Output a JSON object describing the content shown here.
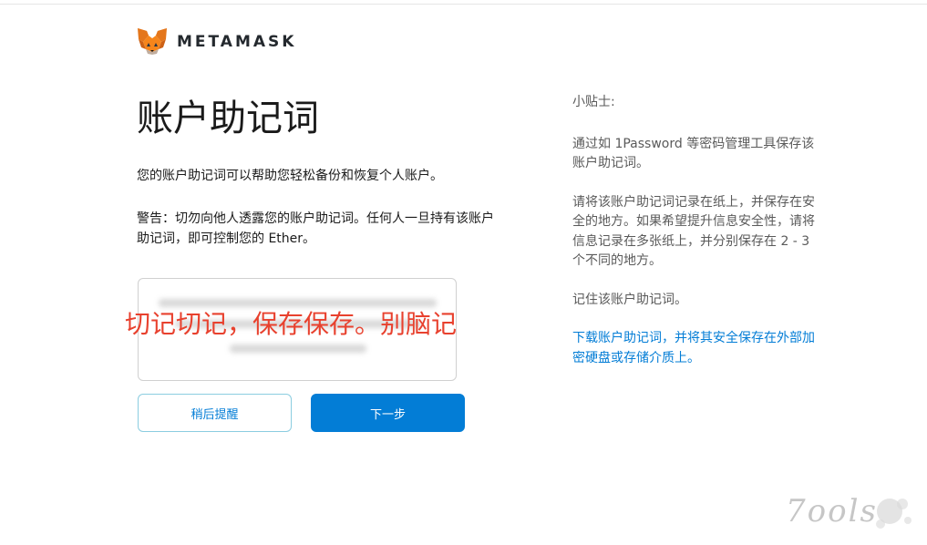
{
  "brand": {
    "wordmark": "METAMASK",
    "icon": "metamask-fox-icon"
  },
  "main": {
    "title": "账户助记词",
    "description": "您的账户助记词可以帮助您轻松备份和恢复个人账户。",
    "warning": "警告：切勿向他人透露您的账户助记词。任何人一旦持有该账户助记词，即可控制您的 Ether。",
    "seed_phrase_state": "blurred",
    "overlay_note": "切记切记，保存保存。别脑记",
    "buttons": {
      "remind_later": "稍后提醒",
      "next": "下一步"
    }
  },
  "tips": {
    "title": "小贴士:",
    "tip1": "通过如 1Password 等密码管理工具保存该账户助记词。",
    "tip2": "请将该账户助记词记录在纸上，并保存在安全的地方。如果希望提升信息安全性，请将信息记录在多张纸上，并分别保存在 2 - 3 个不同的地方。",
    "tip3": "记住该账户助记词。",
    "download_link": "下载账户助记词，并将其安全保存在外部加密硬盘或存储介质上。"
  },
  "watermark": {
    "text": "7ools"
  },
  "colors": {
    "accent": "#037dd6",
    "overlay_note": "#e8412e",
    "secondary_border": "#8bcde0"
  }
}
